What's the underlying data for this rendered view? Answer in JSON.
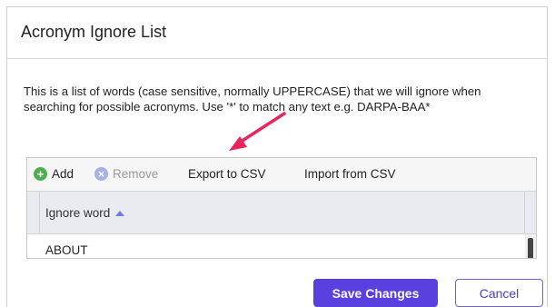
{
  "dialog": {
    "title": "Acronym Ignore List",
    "description": "This is a list of words (case sensitive, normally UPPERCASE) that we will ignore when searching for possible acronyms. Use '*' to match any text e.g. DARPA-BAA*"
  },
  "toolbar": {
    "add_label": "Add",
    "remove_label": "Remove",
    "export_label": "Export to CSV",
    "import_label": "Import from CSV",
    "add_icon": "plus-circle-icon",
    "remove_icon": "x-circle-icon"
  },
  "grid": {
    "column_header": "Ignore word",
    "sort_direction": "ascending",
    "rows": [
      "ABOUT"
    ]
  },
  "buttons": {
    "save_label": "Save Changes",
    "cancel_label": "Cancel"
  },
  "colors": {
    "primary": "#5940df",
    "add_icon": "#4caf50",
    "remove_icon": "#a9aee8",
    "annotation_arrow": "#e8255c"
  }
}
